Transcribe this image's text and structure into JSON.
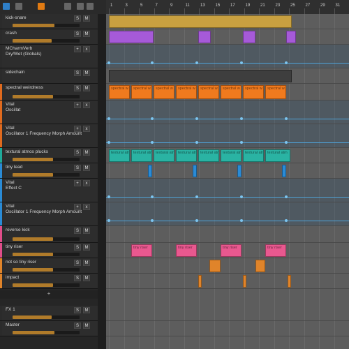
{
  "app": {
    "toolbar_icons": [
      "pointer-icon",
      "grid-icon",
      "clip-view-icon",
      "loop-icon"
    ],
    "ruler_marks": [
      "1",
      "3",
      "5",
      "7",
      "9",
      "11",
      "13",
      "15",
      "17",
      "19",
      "21",
      "23",
      "25",
      "27",
      "29",
      "31",
      "33"
    ]
  },
  "tracks": [
    {
      "id": "kick-snare",
      "name": "kick-snare",
      "color": "#2b2b2b",
      "fader": 0.62,
      "buttons": [
        "S",
        "M"
      ]
    },
    {
      "id": "crash",
      "name": "crash",
      "color": "#2b2b2b",
      "fader": 0.58,
      "buttons": [
        "S",
        "M"
      ]
    },
    {
      "id": "mcharmverb",
      "name": "MCharmVerb",
      "sub": "Dry/Wet (Globals)",
      "color": "#2b2b2b",
      "buttons": [
        "+",
        "x"
      ]
    },
    {
      "id": "sidechain",
      "name": "sidechain",
      "color": "#2b2b2b",
      "buttons": [
        "S",
        "M"
      ]
    },
    {
      "id": "spectral-weirdness",
      "name": "spectral weirdness",
      "color": "#e06a1e",
      "fader": 0.6,
      "buttons": [
        "S",
        "M"
      ]
    },
    {
      "id": "vital-oscillat",
      "name": "Vital",
      "sub": "Oscillat",
      "color": "#e06a1e",
      "buttons": [
        "+",
        "x"
      ]
    },
    {
      "id": "vital-osc-morph",
      "name": "Vital",
      "sub": "Oscillator 1 Frequency Morph Amount",
      "color": "#e06a1e",
      "buttons": [
        "+",
        "x"
      ]
    },
    {
      "id": "textural-atmos-plucks",
      "name": "textural atmos plucks",
      "color": "#1fa99a",
      "fader": 0.6,
      "buttons": [
        "S",
        "M"
      ]
    },
    {
      "id": "tiny-lead",
      "name": "tiny lead",
      "color": "#2a8bd6",
      "fader": 0.6,
      "buttons": [
        "S",
        "M"
      ]
    },
    {
      "id": "vital-effect-c",
      "name": "Vital",
      "sub": "Effect C",
      "color": "#2a8bd6",
      "buttons": [
        "+",
        "x"
      ]
    },
    {
      "id": "vital-osc-morph-2",
      "name": "Vital",
      "sub": "Oscillator 1 Frequency Morph Amount",
      "color": "#2a8bd6",
      "buttons": [
        "+",
        "x"
      ]
    },
    {
      "id": "reverse-kick",
      "name": "reverse kick",
      "color": "#e14d8a",
      "fader": 0.6,
      "buttons": [
        "S",
        "M"
      ]
    },
    {
      "id": "tiny-riser",
      "name": "tiny riser",
      "color": "#e14d8a",
      "fader": 0.6,
      "buttons": [
        "S",
        "M"
      ]
    },
    {
      "id": "not-so-tiny-riser",
      "name": "not so tiny riser",
      "color": "#e0842a",
      "fader": 0.6,
      "buttons": [
        "S",
        "M"
      ]
    },
    {
      "id": "impact",
      "name": "impact",
      "color": "#e0842a",
      "fader": 0.6,
      "buttons": [
        "S",
        "M"
      ]
    },
    {
      "id": "fx1",
      "name": "FX 1",
      "color": "#2b2b2b",
      "fader": 0.58,
      "buttons": [
        "S",
        "M"
      ]
    },
    {
      "id": "master",
      "name": "Master",
      "color": "#2b2b2b",
      "fader": 0.62,
      "buttons": [
        "S",
        "M"
      ]
    }
  ],
  "clips": [
    {
      "lane": "spectral-weirdness",
      "label": "spectral w",
      "color": "#f07a1e"
    },
    {
      "lane": "textural-atmos-plucks",
      "label": "textural atm",
      "color": "#2ab3a3"
    },
    {
      "lane": "tiny-riser",
      "label": "tiny riser",
      "color": "#e9588f"
    },
    {
      "lane": "not-so-tiny-riser",
      "label": "",
      "color": "#e0842a"
    },
    {
      "lane": "impact",
      "label": "",
      "color": "#e0842a"
    }
  ],
  "add_button_label": "+"
}
